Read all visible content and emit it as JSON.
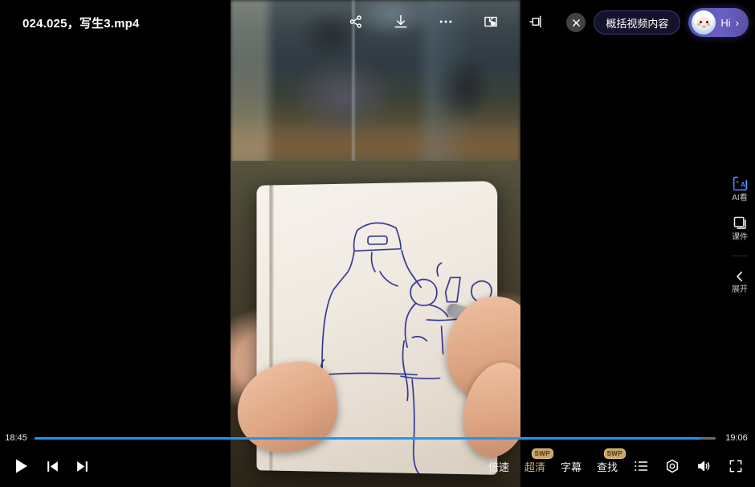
{
  "player": {
    "title": "024.025，写生3.mp4",
    "top_icons": [
      {
        "name": "share-icon",
        "label": "分享"
      },
      {
        "name": "download-icon",
        "label": "下载"
      },
      {
        "name": "more-icon",
        "label": "更多"
      },
      {
        "name": "picture-in-picture-icon",
        "label": "小窗"
      },
      {
        "name": "cast-icon",
        "label": "投屏"
      }
    ],
    "close_label": "×",
    "summary_button": "概括视频内容",
    "assistant": {
      "greeting": "Hi",
      "chevron": "›"
    }
  },
  "rail": {
    "items": [
      {
        "label": "AI看",
        "icon": "ai-watch-icon"
      },
      {
        "label": "课件",
        "icon": "courseware-icon"
      },
      {
        "label": "展开",
        "icon": "chevron-left-icon"
      }
    ]
  },
  "progress": {
    "current_time": "18:45",
    "total_time": "19:06",
    "percent": 97.6,
    "fill_color": "#2196f3",
    "track_color": "#6b6b6b"
  },
  "controls": {
    "play_label": "播放",
    "prev_label": "上一个",
    "next_label": "下一个",
    "speed_label": "倍速",
    "quality_label": "超清",
    "quality_badge": "SWP",
    "subtitle_label": "字幕",
    "search_label": "查找",
    "search_badge": "SWP",
    "playlist_label": "列表",
    "settings_label": "设置",
    "volume_label": "音量",
    "fullscreen_label": "全屏",
    "accent_gold": "#d8b06a"
  }
}
